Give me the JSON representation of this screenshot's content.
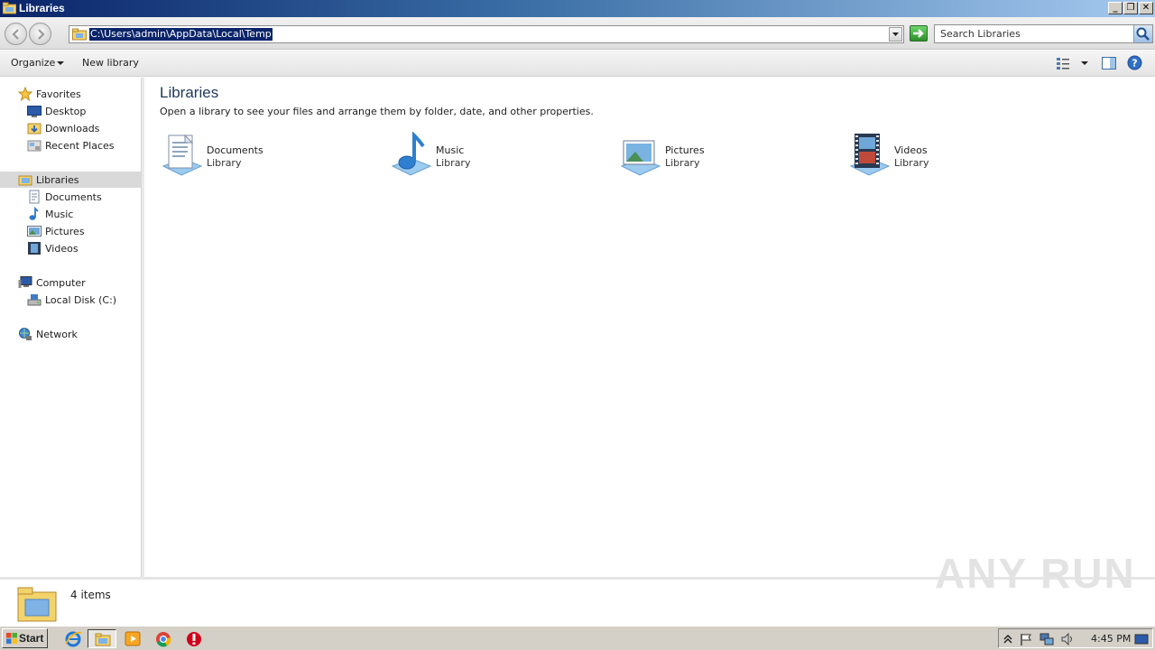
{
  "window": {
    "title": "Libraries",
    "buttons": {
      "minimize": "_",
      "restore": "❐",
      "close": "✕"
    }
  },
  "address": {
    "path": "C:\\Users\\admin\\AppData\\Local\\Temp",
    "search_placeholder": "Search Libraries"
  },
  "toolbar": {
    "organize": "Organize",
    "new_library": "New library"
  },
  "nav": {
    "favorites": "Favorites",
    "desktop": "Desktop",
    "downloads": "Downloads",
    "recent_places": "Recent Places",
    "libraries": "Libraries",
    "documents": "Documents",
    "music": "Music",
    "pictures": "Pictures",
    "videos": "Videos",
    "computer": "Computer",
    "local_disk": "Local Disk (C:)",
    "network": "Network"
  },
  "content": {
    "heading": "Libraries",
    "subtitle": "Open a library to see your files and arrange them by folder, date, and other properties.",
    "libraries": [
      {
        "name": "Documents",
        "kind": "Library",
        "icon": "documents-library-icon"
      },
      {
        "name": "Music",
        "kind": "Library",
        "icon": "music-library-icon"
      },
      {
        "name": "Pictures",
        "kind": "Library",
        "icon": "pictures-library-icon"
      },
      {
        "name": "Videos",
        "kind": "Library",
        "icon": "videos-library-icon"
      }
    ]
  },
  "status": {
    "item_count": "4 items"
  },
  "watermark": "ANY RUN",
  "taskbar": {
    "start": "Start",
    "clock": "4:45 PM",
    "pinned": [
      "internet-explorer-icon",
      "windows-explorer-icon",
      "media-player-icon",
      "chrome-icon",
      "antivirus-icon"
    ]
  },
  "colors": {
    "title_gradient_start": "#0a246a",
    "selection": "#0a246a",
    "heading": "#1e395b",
    "taskbar": "#d4d0c8"
  }
}
